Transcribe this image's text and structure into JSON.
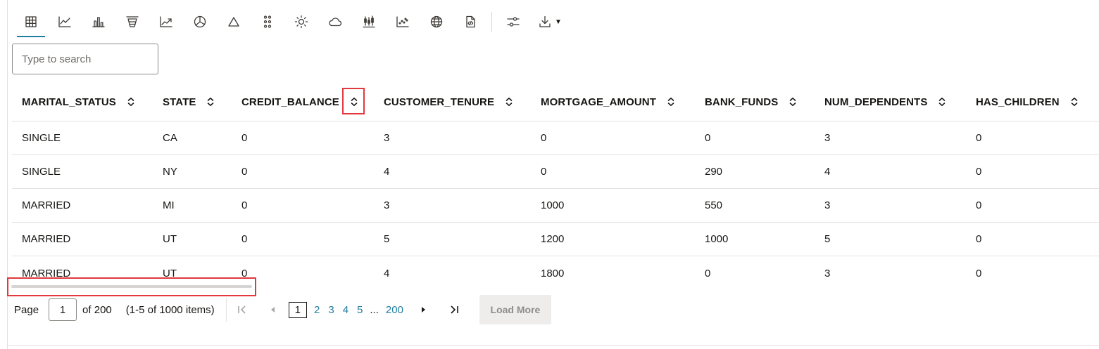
{
  "toolbar": {
    "icons": [
      "table-icon",
      "line-chart-icon",
      "bar-chart-icon",
      "funnel-chart-icon",
      "trend-chart-icon",
      "pie-chart-icon",
      "pyramid-icon",
      "dot-grid-icon",
      "sun-icon",
      "cloud-icon",
      "candlestick-icon",
      "scatter-icon",
      "globe-icon",
      "script-icon",
      "settings-sliders-icon",
      "download-icon"
    ],
    "active": "table-icon",
    "accent_color": "#227e9e"
  },
  "search": {
    "placeholder": "Type to search"
  },
  "table": {
    "columns": [
      "MARITAL_STATUS",
      "STATE",
      "CREDIT_BALANCE",
      "CUSTOMER_TENURE",
      "MORTGAGE_AMOUNT",
      "BANK_FUNDS",
      "NUM_DEPENDENTS",
      "HAS_CHILDREN"
    ],
    "rows": [
      [
        "SINGLE",
        "CA",
        "0",
        "3",
        "0",
        "0",
        "3",
        "0"
      ],
      [
        "SINGLE",
        "NY",
        "0",
        "4",
        "0",
        "290",
        "4",
        "0"
      ],
      [
        "MARRIED",
        "MI",
        "0",
        "3",
        "1000",
        "550",
        "3",
        "0"
      ],
      [
        "MARRIED",
        "UT",
        "0",
        "5",
        "1200",
        "1000",
        "5",
        "0"
      ],
      [
        "MARRIED",
        "UT",
        "0",
        "4",
        "1800",
        "0",
        "3",
        "0"
      ]
    ]
  },
  "pager": {
    "page_label": "Page",
    "current_page": "1",
    "of_label": "of 200",
    "range_label": "(1-5 of 1000 items)",
    "pages": [
      "1",
      "2",
      "3",
      "4",
      "5"
    ],
    "ellipsis": "...",
    "last_page": "200",
    "load_more_label": "Load More"
  },
  "highlight_color": "#e0393e"
}
